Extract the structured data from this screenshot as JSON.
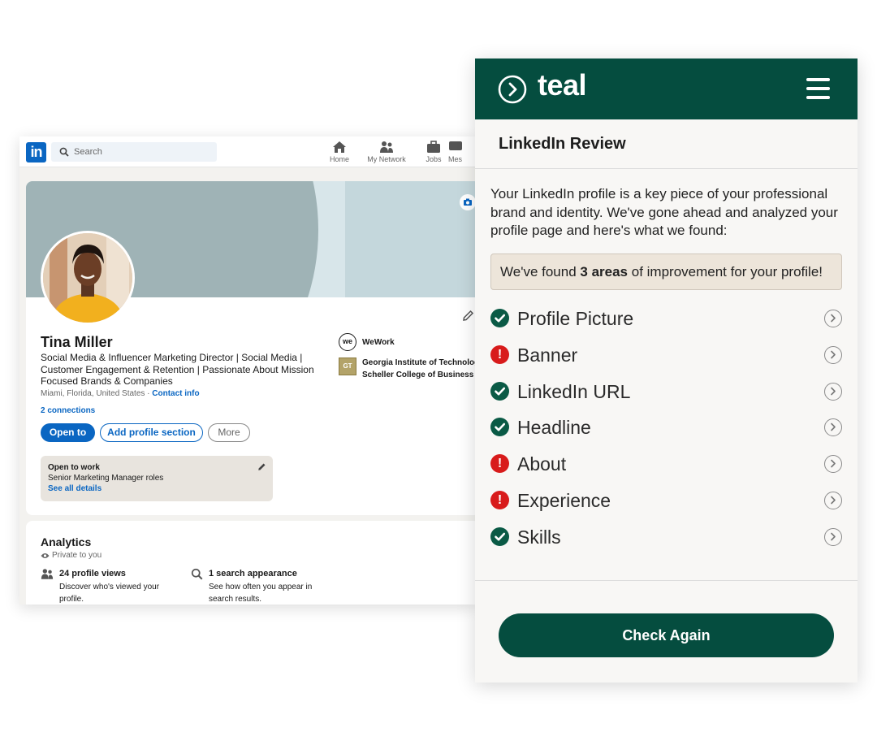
{
  "linkedin": {
    "logo": "in",
    "search_placeholder": "Search",
    "nav": [
      {
        "label": "Home",
        "icon": "home-icon"
      },
      {
        "label": "My Network",
        "icon": "network-icon"
      },
      {
        "label": "Jobs",
        "icon": "briefcase-icon"
      },
      {
        "label": "Mes",
        "icon": "messaging-icon"
      }
    ],
    "profile": {
      "name": "Tina Miller",
      "headline": "Social Media & Influencer Marketing Director | Social Media | Customer Engagement & Retention | Passionate About Mission Focused Brands & Companies",
      "location": "Miami, Florida, United States · ",
      "contact": "Contact info",
      "connections": "2 connections",
      "buttons": {
        "open_to": "Open to",
        "add_section": "Add profile section",
        "more": "More"
      },
      "experience_company": "WeWork",
      "experience_logo": "we",
      "education_school": "Georgia Institute of Technology Scheller College of Business",
      "education_logo": "GT"
    },
    "open_to_work": {
      "title": "Open to work",
      "roles": "Senior Marketing Manager roles",
      "link": "See all details"
    },
    "analytics": {
      "title": "Analytics",
      "visibility": "Private to you",
      "profile_views": "24 profile views",
      "profile_views_sub": "Discover who's viewed your profile.",
      "search_appearance": "1 search appearance",
      "search_appearance_sub": "See how often you appear in search results."
    },
    "colors": {
      "brand": "#0a66c2"
    }
  },
  "teal": {
    "wordmark": "teal",
    "title": "LinkedIn Review",
    "intro": "Your LinkedIn profile is a key piece of your professional brand and identity. We've gone ahead and analyzed your profile page and here's what we found:",
    "found_prefix": "We've found ",
    "found_bold": "3 areas",
    "found_suffix": " of improvement for your profile!",
    "items": [
      {
        "label": "Profile Picture",
        "status": "ok"
      },
      {
        "label": "Banner",
        "status": "bad"
      },
      {
        "label": "LinkedIn URL",
        "status": "ok"
      },
      {
        "label": "Headline",
        "status": "ok"
      },
      {
        "label": "About",
        "status": "bad"
      },
      {
        "label": "Experience",
        "status": "bad"
      },
      {
        "label": "Skills",
        "status": "ok"
      }
    ],
    "warning_glyph": "!",
    "button": "Check Again",
    "colors": {
      "header": "#054d3f",
      "ok": "#0a5a45",
      "bad": "#d81b1b"
    }
  }
}
